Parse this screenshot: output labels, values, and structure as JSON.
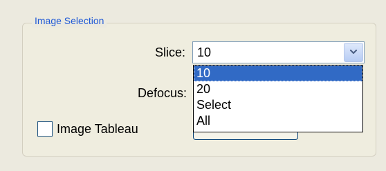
{
  "group": {
    "title": "Image Selection"
  },
  "slice": {
    "label": "Slice:",
    "selected_value": "10",
    "dropdown_icon": "chevron-down-icon",
    "options": [
      "10",
      "20",
      "Select",
      "All"
    ]
  },
  "defocus": {
    "label": "Defocus:"
  },
  "image_tableau": {
    "label": "Image Tableau",
    "checked": false
  },
  "colors": {
    "group_title": "#1f59d6",
    "selected_option_bg": "#316ac5",
    "background": "#eceadf"
  }
}
